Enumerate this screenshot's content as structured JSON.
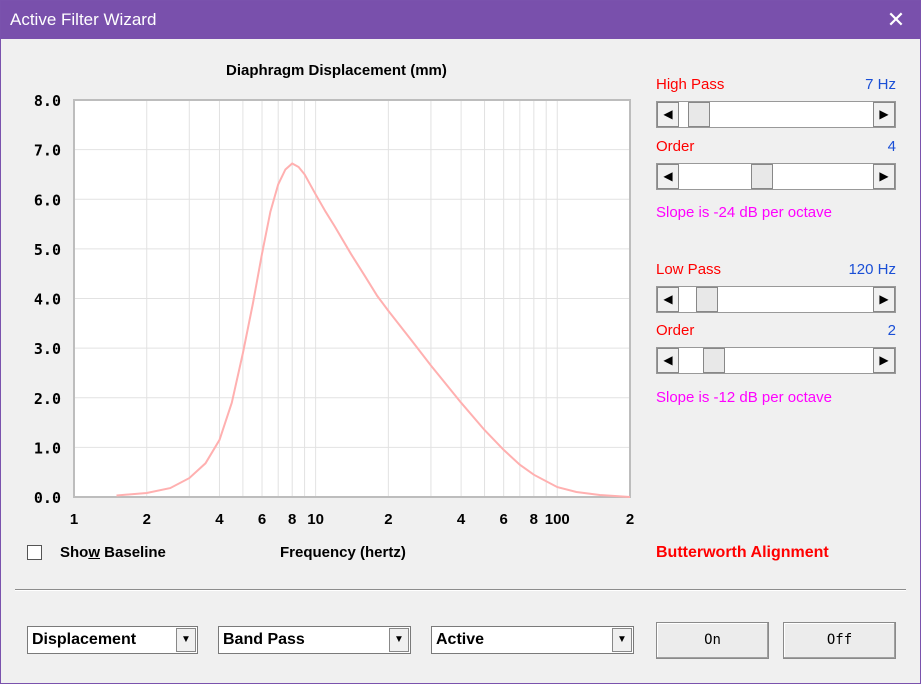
{
  "window": {
    "title": "Active Filter Wizard"
  },
  "chart_data": {
    "type": "line",
    "title": "Diaphragm Displacement (mm)",
    "xlabel": "Frequency (hertz)",
    "ylabel": "",
    "xscale": "log",
    "xlim": [
      1,
      200
    ],
    "ylim": [
      0,
      8
    ],
    "grid": true,
    "yticks": [
      "0.0",
      "1.0",
      "2.0",
      "3.0",
      "4.0",
      "5.0",
      "6.0",
      "7.0",
      "8.0"
    ],
    "xtick_values": [
      1,
      2,
      4,
      6,
      8,
      10,
      20,
      40,
      60,
      80,
      100,
      200
    ],
    "xtick_labels": [
      "1",
      "2",
      "4",
      "6",
      "8",
      "10",
      "2",
      "4",
      "6",
      "8",
      "100",
      "2"
    ],
    "color": "#ffb0b0",
    "series": [
      {
        "x": [
          1.5,
          2.0,
          2.5,
          3.0,
          3.5,
          4.0,
          4.5,
          5.0,
          5.5,
          6.0,
          6.5,
          7.0,
          7.5,
          8.0,
          8.5,
          9.0,
          10,
          11,
          12,
          14,
          16,
          18,
          20,
          25,
          30,
          40,
          50,
          60,
          70,
          80,
          100,
          120,
          150,
          200
        ],
        "y": [
          0.03,
          0.08,
          0.18,
          0.38,
          0.68,
          1.15,
          1.9,
          2.9,
          3.9,
          4.9,
          5.75,
          6.3,
          6.6,
          6.72,
          6.65,
          6.5,
          6.1,
          5.75,
          5.45,
          4.9,
          4.45,
          4.05,
          3.75,
          3.15,
          2.65,
          1.9,
          1.35,
          0.95,
          0.65,
          0.45,
          0.2,
          0.1,
          0.04,
          0.0
        ]
      }
    ]
  },
  "baseline": {
    "label_pre": "Sho",
    "label_key": "w",
    "label_post": " Baseline"
  },
  "highpass": {
    "label": "High Pass",
    "value": "7 Hz",
    "position": 0.05
  },
  "hp_order": {
    "label": "Order",
    "value": "4",
    "position": 0.42
  },
  "hp_slope": "Slope is -24 dB per octave",
  "lowpass": {
    "label": "Low Pass",
    "value": "120 Hz",
    "position": 0.1
  },
  "lp_order": {
    "label": "Order",
    "value": "2",
    "position": 0.14
  },
  "lp_slope": "Slope is -12 dB per octave",
  "alignment": "Butterworth Alignment",
  "combos": {
    "mode": "Displacement",
    "filter": "Band Pass",
    "type": "Active"
  },
  "buttons": {
    "on": "On",
    "off": "Off"
  },
  "icons": {
    "close": "close-icon",
    "arrow_left": "arrow-left-icon",
    "arrow_right": "arrow-right-icon",
    "dropdown": "chevron-down-icon"
  }
}
